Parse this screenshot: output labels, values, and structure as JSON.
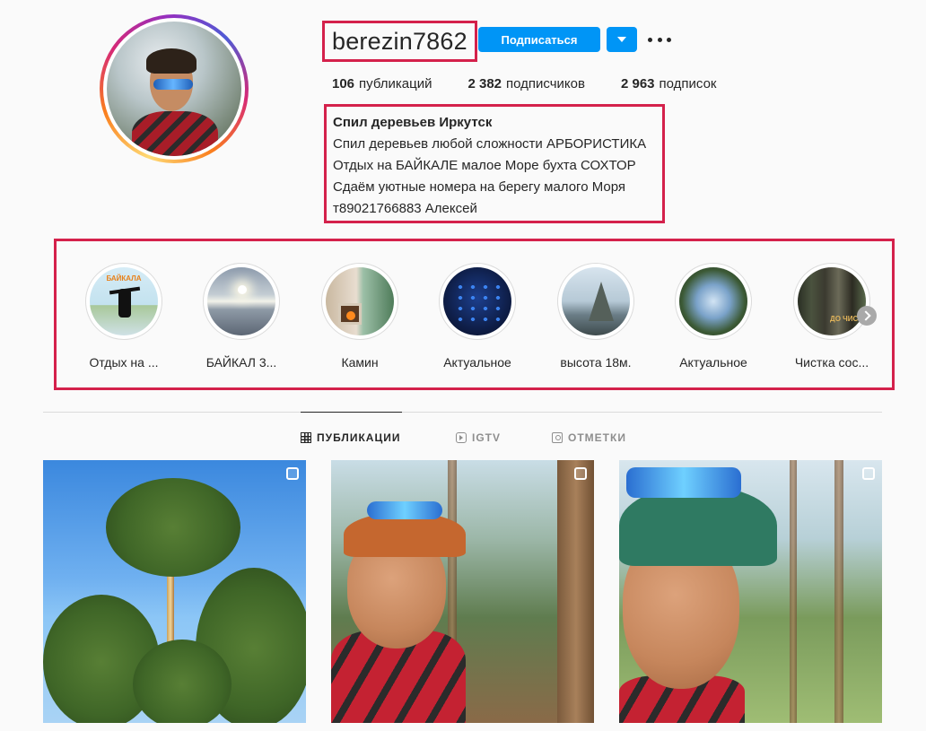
{
  "profile": {
    "username": "berezin7862",
    "follow_label": "Подписаться",
    "stats": [
      {
        "count": "106",
        "label": "публикаций"
      },
      {
        "count": "2 382",
        "label": "подписчиков"
      },
      {
        "count": "2 963",
        "label": "подписок"
      }
    ],
    "bio": {
      "name": "Спил деревьев Иркутск",
      "lines": [
        "Спил деревьев любой сложности АРБОРИСТИКА",
        "Отдых на БАЙКАЛЕ малое Море бухта СОХТОР",
        "Сдаём уютные номера на берегу малого Моря",
        "т89021766883 Алексей"
      ]
    }
  },
  "highlights": [
    {
      "label": "Отдых на ...",
      "icon": "baikal-jump-image",
      "image_text": "БАЙКАЛА"
    },
    {
      "label": "БАЙКАЛ 3...",
      "icon": "lake-sunset-image"
    },
    {
      "label": "Камин",
      "icon": "fireplace-image"
    },
    {
      "label": "Актуальное",
      "icon": "price-list-image"
    },
    {
      "label": "высота 18м.",
      "icon": "tree-height-image"
    },
    {
      "label": "Актуальное",
      "icon": "pine-crowns-image"
    },
    {
      "label": "Чистка сос...",
      "icon": "pine-forest-image",
      "image_text": "ДО ЧИСТ"
    }
  ],
  "tabs": [
    {
      "label": "ПУБЛИКАЦИИ",
      "icon": "grid-icon",
      "active": true
    },
    {
      "label": "IGTV",
      "icon": "igtv-icon",
      "active": false
    },
    {
      "label": "ОТМЕТКИ",
      "icon": "tagged-icon",
      "active": false
    }
  ],
  "posts": [
    {
      "subject": "pine-trees-climber"
    },
    {
      "subject": "selfie-red-cap"
    },
    {
      "subject": "selfie-green-cap"
    }
  ],
  "colors": {
    "accent_blue": "#0095f6",
    "annotation_red": "#d4214b",
    "text": "#262626",
    "muted": "#8e8e8e"
  }
}
